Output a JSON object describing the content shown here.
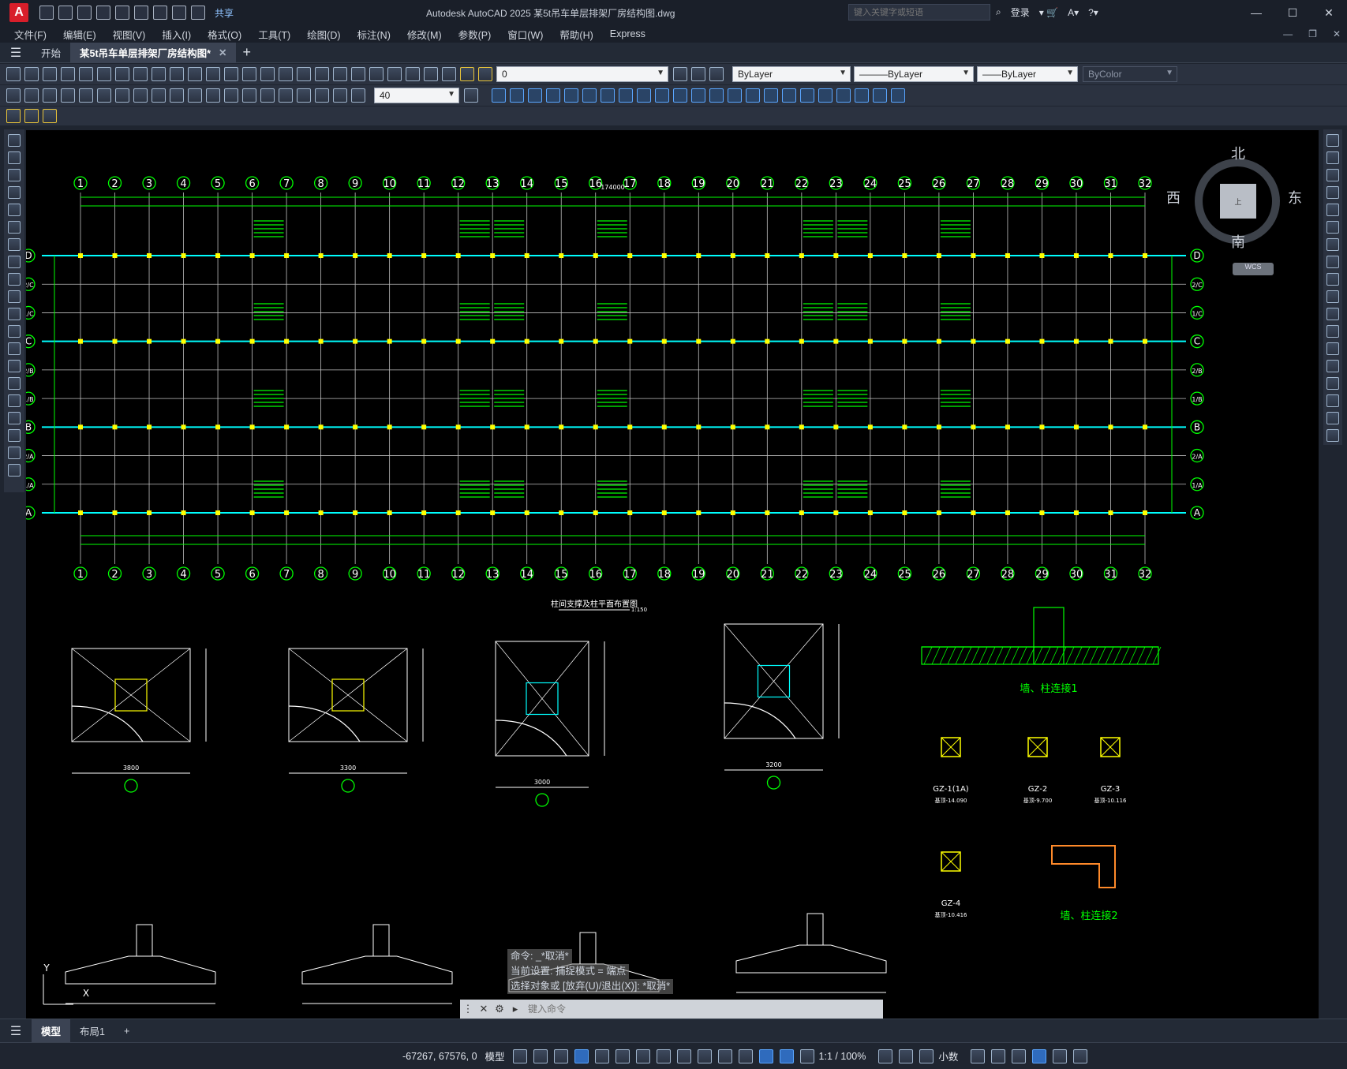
{
  "window": {
    "title": "Autodesk AutoCAD 2025    某5t吊车单层排架厂房结构图.dwg",
    "share_label": "共享",
    "search_placeholder": "键入关键字或短语",
    "login_label": "登录"
  },
  "menu": [
    "文件(F)",
    "编辑(E)",
    "视图(V)",
    "插入(I)",
    "格式(O)",
    "工具(T)",
    "绘图(D)",
    "标注(N)",
    "修改(M)",
    "参数(P)",
    "窗口(W)",
    "帮助(H)",
    "Express"
  ],
  "tabs": {
    "start": "开始",
    "drawing": "某5t吊车单层排架厂房结构图*"
  },
  "properties": {
    "layer_value": "0",
    "color": "ByLayer",
    "linetype": "ByLayer",
    "lineweight": "ByLayer",
    "plotstyle": "ByColor",
    "dim_scale": "40"
  },
  "viewcube": {
    "north": "北",
    "south": "南",
    "east": "东",
    "west": "西",
    "top": "上",
    "wcs": "WCS"
  },
  "drawing": {
    "axes_numbers": [
      "1",
      "2",
      "3",
      "4",
      "5",
      "6",
      "7",
      "8",
      "9",
      "10",
      "11",
      "12",
      "13",
      "14",
      "15",
      "16",
      "17",
      "18",
      "19",
      "20",
      "21",
      "22",
      "23",
      "24",
      "25",
      "26",
      "27",
      "28",
      "29",
      "30",
      "31",
      "32"
    ],
    "axes_letters": [
      "D",
      "2/C",
      "1/C",
      "C",
      "2/B",
      "1/B",
      "B",
      "2/A",
      "1/A",
      "A"
    ],
    "overall_dim": "174000",
    "plan_title": "柱间支撑及柱平面布置图",
    "plan_scale": "1:150",
    "wall_detail_1": "墙、柱连接1",
    "wall_detail_2": "墙、柱连接2",
    "gz_labels": [
      "GZ-1(1A)",
      "GZ-2",
      "GZ-3",
      "GZ-4"
    ],
    "gz_elev": [
      "基顶-14.090",
      "基顶-9.700",
      "基顶-10.116",
      "基顶-10.416"
    ],
    "foundation_dims": [
      "3800",
      "3300",
      "3000",
      "3200"
    ]
  },
  "command": {
    "history": [
      "命令: _*取消*",
      "当前设置: 捕捉模式 = 端点",
      "选择对象或 [放弃(U)/退出(X)]: *取消*"
    ],
    "placeholder": "键入命令"
  },
  "layouts": {
    "model": "模型",
    "layout1": "布局1"
  },
  "status": {
    "coords": "-67267, 67576, 0",
    "space": "模型",
    "scale": "1:1 / 100%",
    "units": "小数"
  },
  "colors": {
    "bg_dark": "#1f2530",
    "canvas": "#000000",
    "green": "#00ff00",
    "cyan": "#00ffff",
    "yellow": "#ffff00"
  }
}
